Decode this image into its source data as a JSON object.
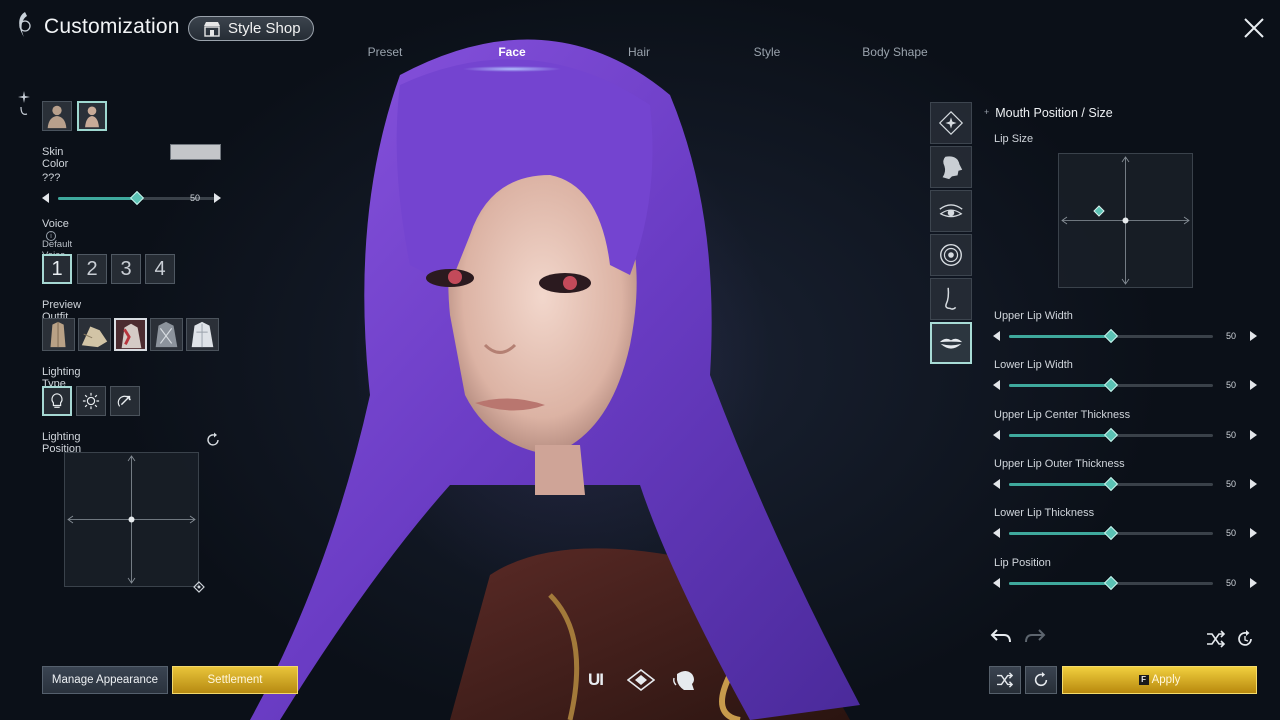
{
  "header": {
    "title": "Customization",
    "style_shop_label": "Style Shop",
    "tabs": [
      {
        "label": "Preset",
        "active": false
      },
      {
        "label": "Face",
        "active": true
      },
      {
        "label": "Hair",
        "active": false
      },
      {
        "label": "Style",
        "active": false
      },
      {
        "label": "Body Shape",
        "active": false
      }
    ]
  },
  "left_panel": {
    "skin_color_label": "Skin Color",
    "skin_color_value": "#c4c6c9",
    "unknown_slider": {
      "label": "???",
      "value": 50,
      "min": 0,
      "max": 100
    },
    "voice": {
      "label": "Voice",
      "sub_label": "Default Voice",
      "options": [
        "1",
        "2",
        "3",
        "4"
      ],
      "selected": "1"
    },
    "preview_outfit_label": "Preview Outfit",
    "preview_outfit_selected": 3,
    "lighting_type_label": "Lighting Type",
    "lighting_type_selected": 1,
    "lighting_position_label": "Lighting Position"
  },
  "right_panel": {
    "categories": [
      {
        "icon": "sparkle-diamond-icon",
        "selected": false
      },
      {
        "icon": "face-profile-icon",
        "selected": false
      },
      {
        "icon": "eye-icon",
        "selected": false
      },
      {
        "icon": "iris-icon",
        "selected": false
      },
      {
        "icon": "nose-icon",
        "selected": false
      },
      {
        "icon": "lips-icon",
        "selected": true
      }
    ],
    "section_title": "Mouth Position / Size",
    "lip_size_label": "Lip Size",
    "sliders": [
      {
        "label": "Upper Lip Width",
        "value": 50
      },
      {
        "label": "Lower Lip Width",
        "value": 50
      },
      {
        "label": "Upper Lip Center Thickness",
        "value": 50
      },
      {
        "label": "Upper Lip Outer Thickness",
        "value": 50
      },
      {
        "label": "Lower Lip Thickness",
        "value": 50
      },
      {
        "label": "Lip Position",
        "value": 50
      }
    ]
  },
  "bottom": {
    "manage_label": "Manage Appearance",
    "settlement_label": "Settlement",
    "ui_label": "UI",
    "apply_key": "F",
    "apply_label": "Apply"
  },
  "colors": {
    "accent_teal": "#3fa99d",
    "gold": "#e2b829",
    "hair_purple": "#6b3fc7"
  }
}
